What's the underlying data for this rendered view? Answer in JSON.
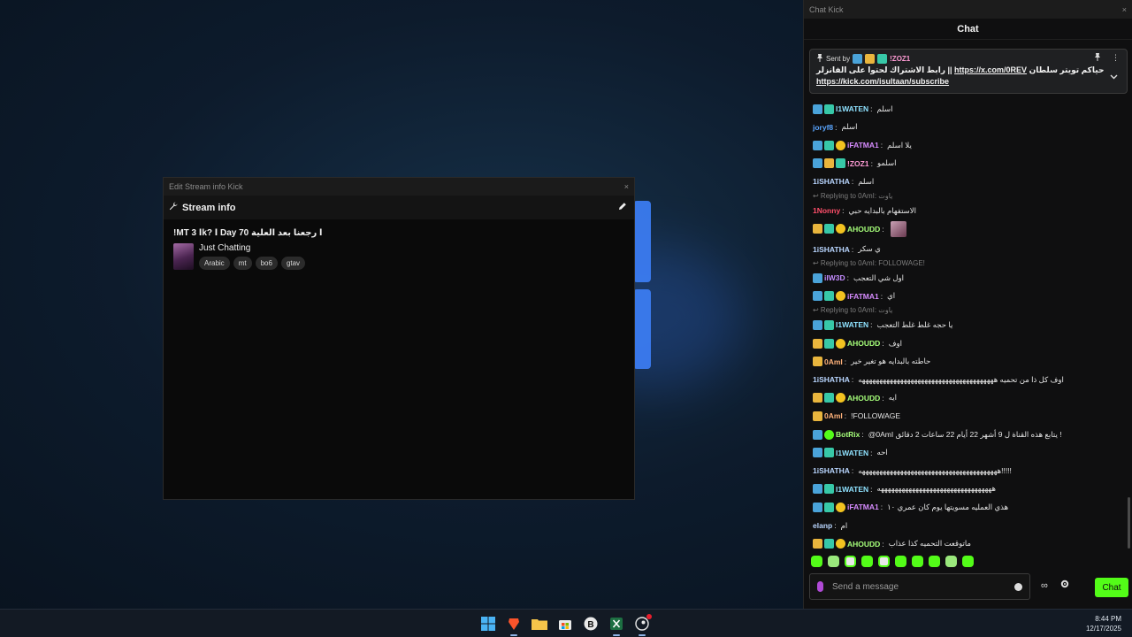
{
  "stream_info_window": {
    "title": "Edit Stream info Kick",
    "close": "×",
    "header": "Stream info",
    "stream_title": "!MT ا 3k? ا Day 70 ا رجعنا بعد العلية",
    "category": "Just Chatting",
    "tags": [
      "Arabic",
      "mt",
      "bo6",
      "gtav"
    ]
  },
  "chat_window": {
    "title": "Chat Kick",
    "close": "×",
    "header": "Chat",
    "pinned": {
      "sent_by_label": "Sent by",
      "sender": "!ZOZ1",
      "text_part1": "رابط الاشتراك لحتوا على الفانزلر || ",
      "link1": "https://x.com/0REV",
      "text_part2": " حياكم تويتر سلطان",
      "link2": "https://kick.com/isultaan/subscribe"
    },
    "messages": [
      {
        "user": "I1WATEN",
        "text": "اسلم",
        "color": "#8fe2ff",
        "badges": [
          "b-blue",
          "b-sub"
        ]
      },
      {
        "user": "joryf8",
        "text": "اسلم",
        "color": "#5aa6ff",
        "badges": []
      },
      {
        "user": "iFATMA1",
        "text": "يلا اسلم",
        "color": "#d78cff",
        "badges": [
          "b-blue",
          "b-sub",
          "b-coin"
        ]
      },
      {
        "user": "!ZOZ1",
        "text": "اسلمو",
        "color": "#ff9bd5",
        "badges": [
          "b-blue",
          "b-crown",
          "b-sub"
        ]
      },
      {
        "user": "1iSHATHA",
        "text": "اسلم",
        "color": "#b9d6ff",
        "badges": []
      },
      {
        "reply": "Replying to 0AmI: ياوت"
      },
      {
        "user": "1Nonny",
        "text": "الاستفهام بالبدايه حبي",
        "color": "#ff4f6a",
        "badges": []
      },
      {
        "user": "AHOUDD",
        "text": "",
        "color": "#a6ff7a",
        "badges": [
          "b-crown",
          "b-sub",
          "b-coin"
        ],
        "emote": true
      },
      {
        "user": "1iSHATHA",
        "text": "ي سكر",
        "color": "#b9d6ff",
        "badges": []
      },
      {
        "reply": "Replying to 0AmI: FOLLOWAGE!"
      },
      {
        "user": "iIW3D",
        "text": "اول شي التعجب",
        "color": "#c48cff",
        "badges": [
          "b-blue"
        ]
      },
      {
        "user": "iFATMA1",
        "text": "اي",
        "color": "#d78cff",
        "badges": [
          "b-blue",
          "b-sub",
          "b-coin"
        ]
      },
      {
        "reply": "Replying to 0AmI: ياوت"
      },
      {
        "user": "I1WATEN",
        "text": "يا حجه غلط غلط التعجب",
        "color": "#8fe2ff",
        "badges": [
          "b-blue",
          "b-sub"
        ]
      },
      {
        "user": "AHOUDD",
        "text": "اوف",
        "color": "#a6ff7a",
        "badges": [
          "b-crown",
          "b-sub",
          "b-coin"
        ]
      },
      {
        "user": "0AmI",
        "text": "حاطته بالبدايه هو تغير خير",
        "color": "#ffb27a",
        "badges": [
          "b-crown"
        ]
      },
      {
        "user": "1iSHATHA",
        "text": "اوف كل ذا من تحميه هههههههههههههههههههههههههههههههههههههههه",
        "color": "#b9d6ff",
        "badges": []
      },
      {
        "user": "AHOUDD",
        "text": "ايه",
        "color": "#a6ff7a",
        "badges": [
          "b-crown",
          "b-sub",
          "b-coin"
        ]
      },
      {
        "user": "0AmI",
        "text": "!FOLLOWAGE",
        "color": "#ffb27a",
        "badges": [
          "b-crown"
        ]
      },
      {
        "user": "BotRix",
        "text": "@0AmI يتابع هذه القناة ل 9 أشهر 22 أيام 22 ساعات 2 دقائق !",
        "color": "#a6ff7a",
        "badges": [
          "b-blue",
          "b-green"
        ]
      },
      {
        "user": "I1WATEN",
        "text": "احه",
        "color": "#8fe2ff",
        "badges": [
          "b-blue",
          "b-sub"
        ]
      },
      {
        "user": "1iSHATHA",
        "text": "ههههههههههههههههههههههههههههههههههههههههه!!!!!",
        "color": "#b9d6ff",
        "badges": []
      },
      {
        "user": "I1WATEN",
        "text": "هههههههههههههههههههههههههههههههههه",
        "color": "#8fe2ff",
        "badges": [
          "b-blue",
          "b-sub"
        ]
      },
      {
        "user": "iFATMA1",
        "text": "هذي العمليه مسويتها يوم كان عمري ١٠",
        "color": "#d78cff",
        "badges": [
          "b-blue",
          "b-sub",
          "b-coin"
        ]
      },
      {
        "user": "elanp",
        "text": "ام",
        "color": "#b9d6ff",
        "badges": []
      },
      {
        "user": "AHOUDD",
        "text": "ماتوقعت التحميه كذا عذاب",
        "color": "#a6ff7a",
        "badges": [
          "b-crown",
          "b-sub",
          "b-coin"
        ]
      }
    ],
    "input_placeholder": "Send a message",
    "send_button": "Chat",
    "points_label": "∞"
  },
  "taskbar": {
    "time": "8:44 PM",
    "date": "12/17/2025"
  }
}
